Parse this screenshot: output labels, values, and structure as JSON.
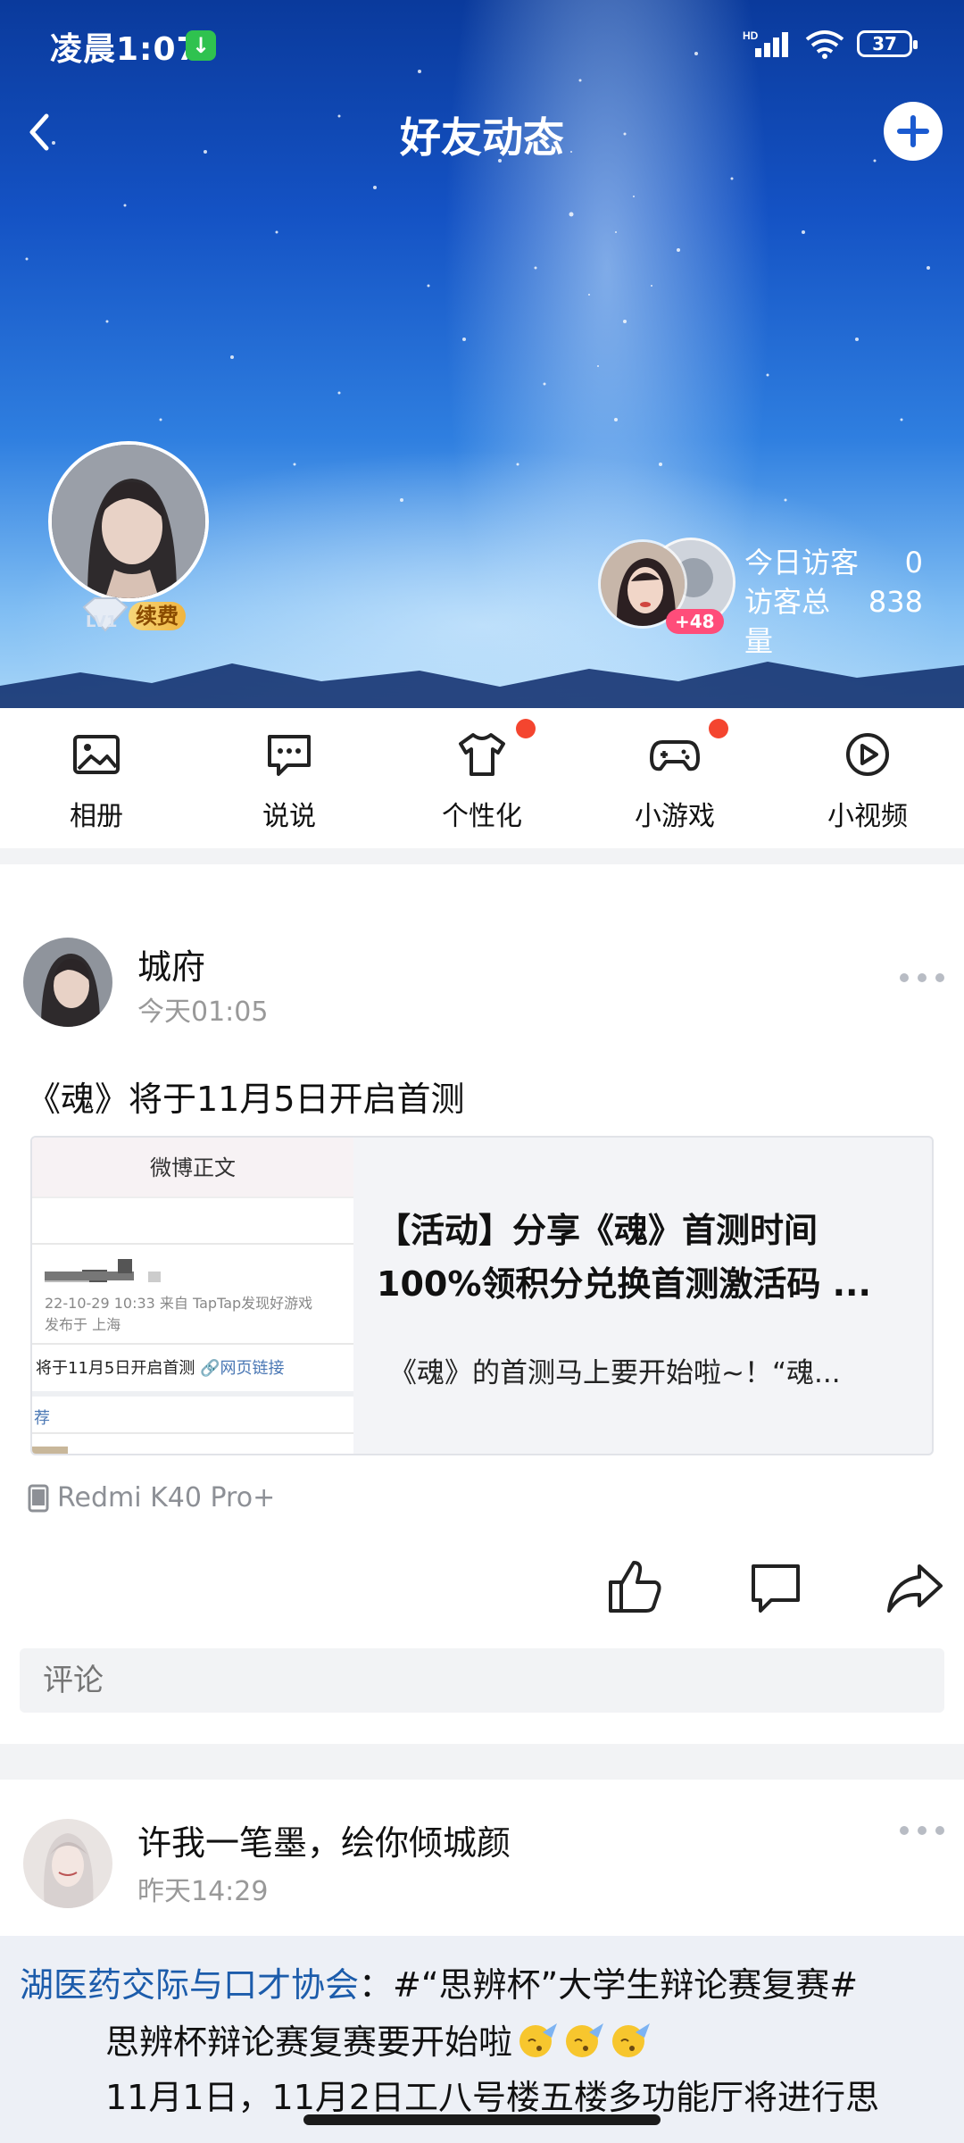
{
  "status_bar": {
    "time": "凌晨1:07",
    "network": "HD",
    "battery": "37"
  },
  "header": {
    "title": "好友动态"
  },
  "profile": {
    "level": "LV1",
    "renew_label": "续费",
    "visitors_more": "+48",
    "today_visitors_label": "今日访客",
    "today_visitors_value": "0",
    "total_visitors_label": "访客总量",
    "total_visitors_value": "838"
  },
  "quick_nav": [
    {
      "label": "相册",
      "icon": "photo-album-icon",
      "badge": false
    },
    {
      "label": "说说",
      "icon": "chat-bubble-icon",
      "badge": false
    },
    {
      "label": "个性化",
      "icon": "tshirt-icon",
      "badge": true
    },
    {
      "label": "小游戏",
      "icon": "gamepad-icon",
      "badge": true
    },
    {
      "label": "小视频",
      "icon": "play-circle-icon",
      "badge": false
    }
  ],
  "post1": {
    "author": "城府",
    "time": "今天01:05",
    "text": "《魂》将于11月5日开启首测",
    "link_card": {
      "thumb_header": "微博正文",
      "thumb_meta": "22-10-29 10:33  来自 TapTap发现好游戏",
      "thumb_location": "发布于 上海",
      "thumb_text": "将于11月5日开启首测",
      "thumb_link": "🔗网页链接",
      "thumb_tag": "荐",
      "title_line1": "【活动】分享《魂》首测时间",
      "title_line2": "100%领积分兑换首测激活码 ...",
      "description": "《魂》的首测马上要开始啦~！“魂..."
    },
    "device": "Redmi K40 Pro+",
    "comment_placeholder": "评论"
  },
  "post2": {
    "author": "许我一笔墨，绘你倾城颜",
    "time": "昨天14:29",
    "topic_account": "湖医药交际与口才协会",
    "line1_rest": "：#“思辨杯”大学生辩论赛复赛#",
    "line2": "思辨杯辩论赛复赛要开始啦",
    "line3": "11月1日，11月2日工八号楼五楼多功能厅将进行思"
  },
  "colors": {
    "accent_blue": "#1c5cab",
    "badge_red": "#f4452f",
    "renew_gold": "#f0b43f"
  }
}
